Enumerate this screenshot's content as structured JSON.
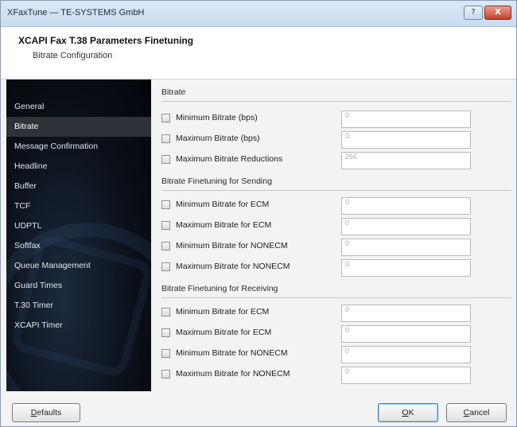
{
  "window": {
    "title": "XFaxTune — TE-SYSTEMS GmbH",
    "help_label": "?",
    "close_label": "X"
  },
  "header": {
    "title": "XCAPI Fax T.38 Parameters Finetuning",
    "subtitle": "Bitrate Configuration"
  },
  "nav": {
    "items": [
      {
        "label": "General"
      },
      {
        "label": "Bitrate",
        "active": true
      },
      {
        "label": "Message Confirmation"
      },
      {
        "label": "Headline"
      },
      {
        "label": "Buffer"
      },
      {
        "label": "TCF"
      },
      {
        "label": "UDPTL"
      },
      {
        "label": "Softfax"
      },
      {
        "label": "Queue Management"
      },
      {
        "label": "Guard Times"
      },
      {
        "label": "T.30 Timer"
      },
      {
        "label": "XCAPI Timer"
      }
    ]
  },
  "sections": [
    {
      "title": "Bitrate",
      "rows": [
        {
          "label": "Minimum Bitrate (bps)",
          "value": "0"
        },
        {
          "label": "Maximum Bitrate (bps)",
          "value": "0"
        },
        {
          "label": "Maximum Bitrate Reductions",
          "value": "256"
        }
      ]
    },
    {
      "title": "Bitrate Finetuning for Sending",
      "rows": [
        {
          "label": "Minimum Bitrate for ECM",
          "value": "0"
        },
        {
          "label": "Maximum Bitrate for ECM",
          "value": "0"
        },
        {
          "label": "Minimum Bitrate for NONECM",
          "value": "0"
        },
        {
          "label": "Maximum Bitrate for NONECM",
          "value": "0"
        }
      ]
    },
    {
      "title": "Bitrate Finetuning for Receiving",
      "rows": [
        {
          "label": "Minimum Bitrate for ECM",
          "value": "0"
        },
        {
          "label": "Maximum Bitrate for ECM",
          "value": "0"
        },
        {
          "label": "Minimum Bitrate for NONECM",
          "value": "0"
        },
        {
          "label": "Maximum Bitrate for NONECM",
          "value": "0"
        }
      ]
    }
  ],
  "buttons": {
    "defaults": {
      "first": "D",
      "rest": "efaults"
    },
    "ok": {
      "first": "O",
      "rest": "K"
    },
    "cancel": {
      "first": "C",
      "rest": "ancel"
    }
  }
}
